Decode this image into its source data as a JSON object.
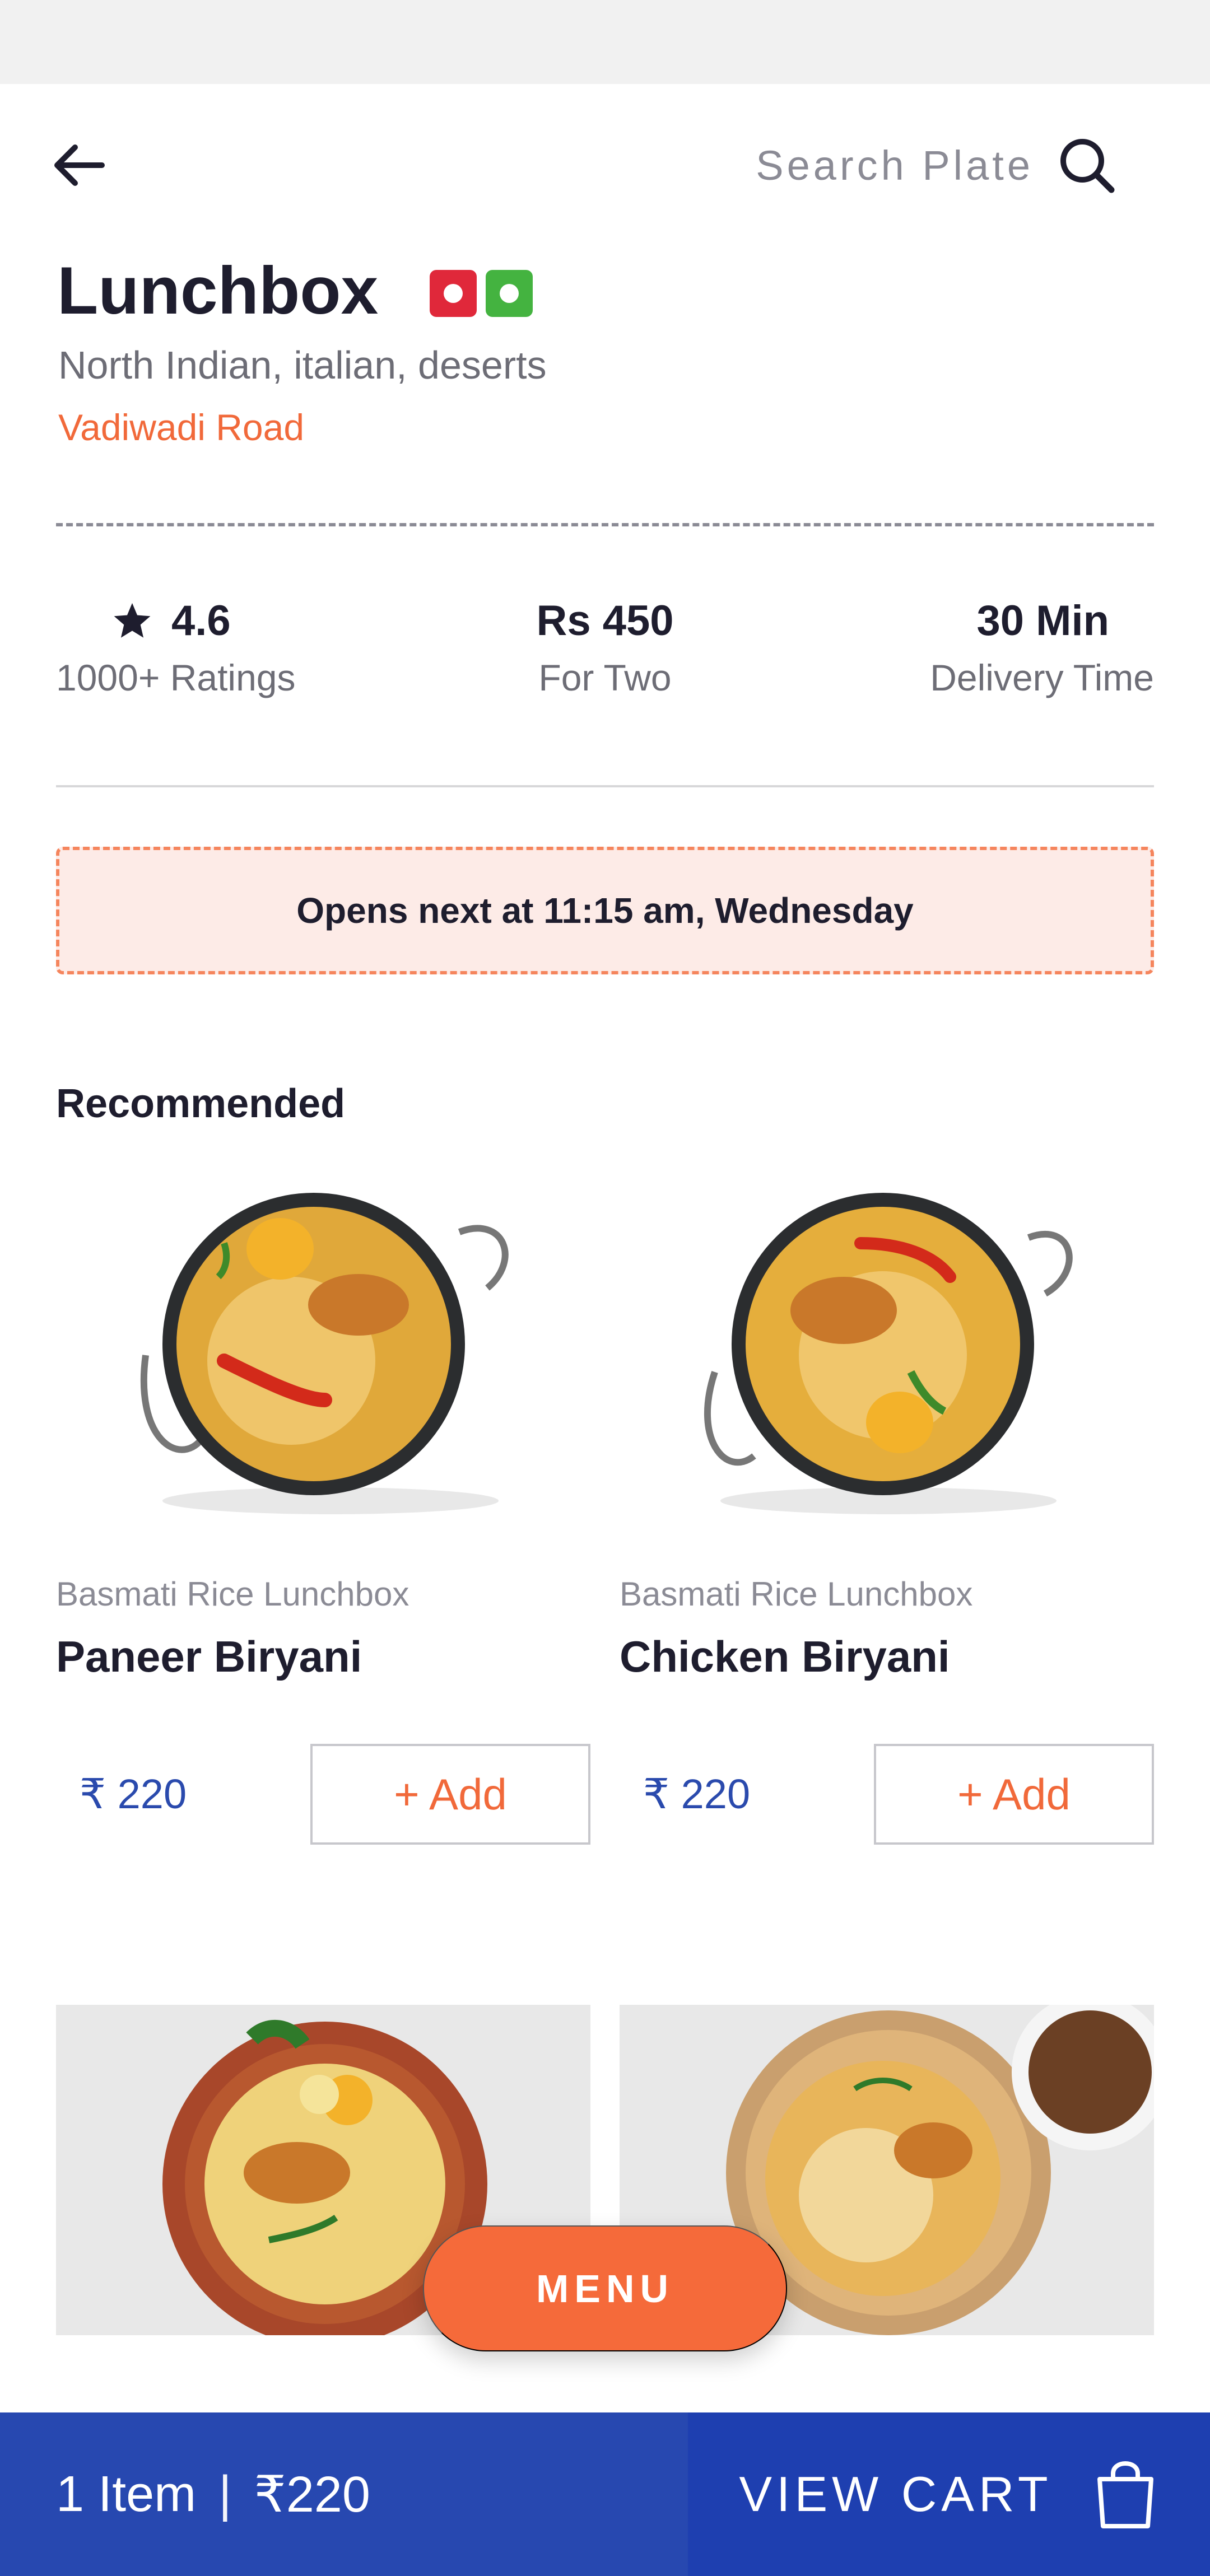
{
  "header": {
    "search_placeholder": "Search Plate"
  },
  "restaurant": {
    "name": "Lunchbox",
    "cuisines": "North Indian, italian, deserts",
    "location": "Vadiwadi Road"
  },
  "stats": {
    "rating_value": "4.6",
    "rating_label": "1000+ Ratings",
    "price_value": "Rs 450",
    "price_label": "For Two",
    "time_value": "30 Min",
    "time_label": "Delivery Time"
  },
  "notice": {
    "text": "Opens next at 11:15 am, Wednesday"
  },
  "recommended": {
    "title": "Recommended",
    "items": [
      {
        "category": "Basmati Rice Lunchbox",
        "name": "Paneer Biryani",
        "price": "₹ 220",
        "add_label": "+ Add"
      },
      {
        "category": "Basmati Rice Lunchbox",
        "name": "Chicken Biryani",
        "price": "₹ 220",
        "add_label": "+ Add"
      }
    ]
  },
  "menu_button": {
    "label": "MENU"
  },
  "cart": {
    "count": "1 Item",
    "separator": "|",
    "total": "₹220",
    "view_label": "VIEW CART"
  },
  "colors": {
    "accent": "#f56a3a",
    "price_blue": "#2a4aad",
    "cart_bar": "#2748b0",
    "nonveg_badge": "#e0283a",
    "veg_badge": "#44b340"
  },
  "icons": [
    "back-arrow-icon",
    "search-icon",
    "star-icon",
    "shopping-bag-icon"
  ]
}
